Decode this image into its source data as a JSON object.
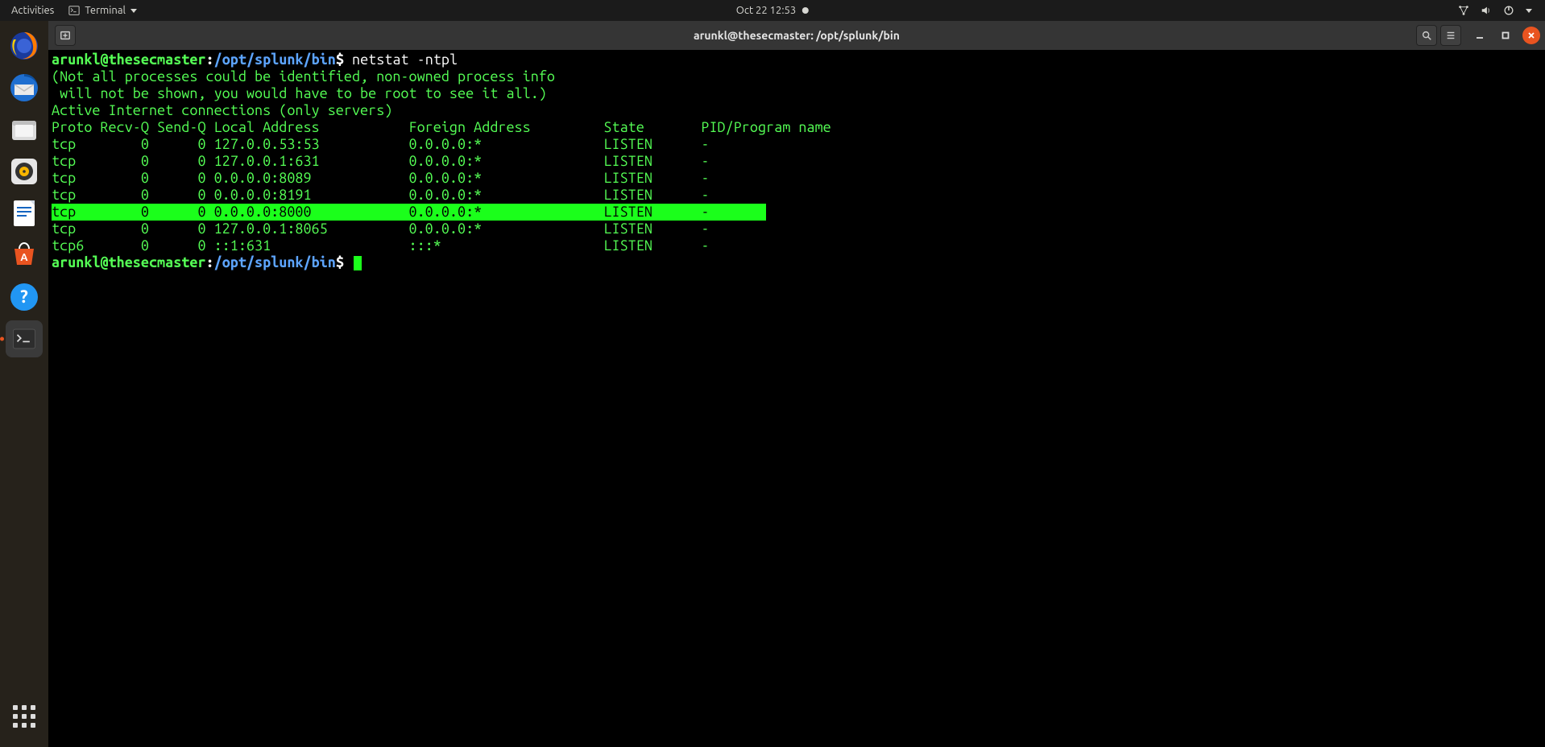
{
  "top_panel": {
    "activities": "Activities",
    "app_name": "Terminal",
    "datetime": "Oct 22  12:53"
  },
  "dock": {
    "items": [
      {
        "name": "firefox-icon"
      },
      {
        "name": "thunderbird-icon"
      },
      {
        "name": "files-icon"
      },
      {
        "name": "rhythmbox-icon"
      },
      {
        "name": "libreoffice-writer-icon"
      },
      {
        "name": "ubuntu-software-icon"
      },
      {
        "name": "help-icon"
      },
      {
        "name": "terminal-icon"
      }
    ]
  },
  "window": {
    "title": "arunkl@thesecmaster: /opt/splunk/bin"
  },
  "prompt": {
    "user_host": "arunkl@thesecmaster",
    "path": "/opt/splunk/bin",
    "symbol": "$"
  },
  "session": {
    "command": "netstat -ntpl",
    "warn_line1": "(Not all processes could be identified, non-owned process info",
    "warn_line2": " will not be shown, you would have to be root to see it all.)",
    "heading": "Active Internet connections (only servers)",
    "columns_line": "Proto Recv-Q Send-Q Local Address           Foreign Address         State       PID/Program name    "
  },
  "netstat_rows": [
    {
      "proto": "tcp",
      "recvq": "0",
      "sendq": "0",
      "local": "127.0.0.53:53",
      "foreign": "0.0.0.0:*",
      "state": "LISTEN",
      "pid": "-",
      "highlight": false
    },
    {
      "proto": "tcp",
      "recvq": "0",
      "sendq": "0",
      "local": "127.0.0.1:631",
      "foreign": "0.0.0.0:*",
      "state": "LISTEN",
      "pid": "-",
      "highlight": false
    },
    {
      "proto": "tcp",
      "recvq": "0",
      "sendq": "0",
      "local": "0.0.0.0:8089",
      "foreign": "0.0.0.0:*",
      "state": "LISTEN",
      "pid": "-",
      "highlight": false
    },
    {
      "proto": "tcp",
      "recvq": "0",
      "sendq": "0",
      "local": "0.0.0.0:8191",
      "foreign": "0.0.0.0:*",
      "state": "LISTEN",
      "pid": "-",
      "highlight": false
    },
    {
      "proto": "tcp",
      "recvq": "0",
      "sendq": "0",
      "local": "0.0.0.0:8000",
      "foreign": "0.0.0.0:*",
      "state": "LISTEN",
      "pid": "-",
      "highlight": true
    },
    {
      "proto": "tcp",
      "recvq": "0",
      "sendq": "0",
      "local": "127.0.0.1:8065",
      "foreign": "0.0.0.0:*",
      "state": "LISTEN",
      "pid": "-",
      "highlight": false
    },
    {
      "proto": "tcp6",
      "recvq": "0",
      "sendq": "0",
      "local": "::1:631",
      "foreign": ":::*",
      "state": "LISTEN",
      "pid": "-",
      "highlight": false
    }
  ]
}
